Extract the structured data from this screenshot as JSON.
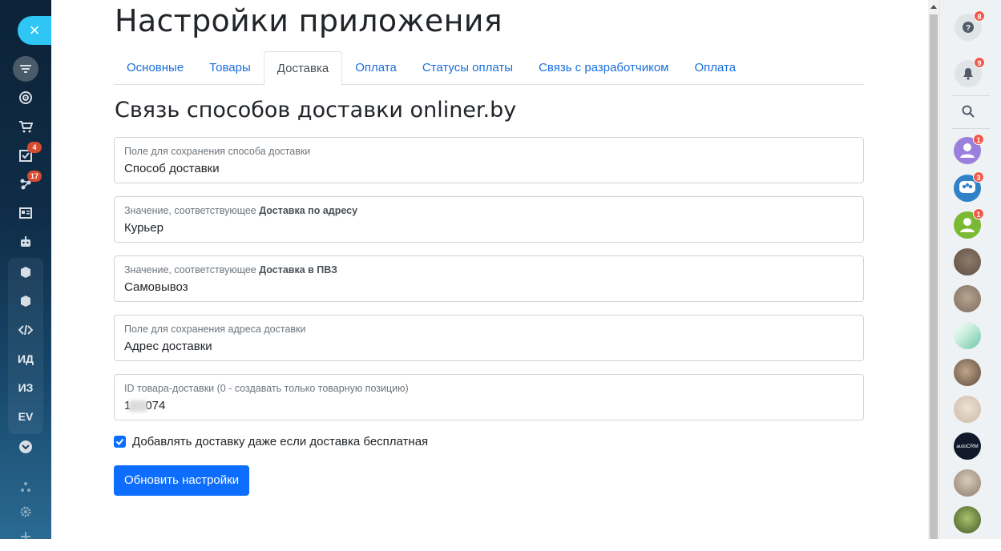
{
  "left_nav": {
    "close_label": "×",
    "text_items": [
      "ИД",
      "ИЗ",
      "EV"
    ],
    "badges": {
      "tasks": "4",
      "crm": "17"
    }
  },
  "page": {
    "app_title": "Настройки приложения",
    "tabs": [
      {
        "label": "Основные",
        "active": false
      },
      {
        "label": "Товары",
        "active": false
      },
      {
        "label": "Доставка",
        "active": true
      },
      {
        "label": "Оплата",
        "active": false
      },
      {
        "label": "Статусы оплаты",
        "active": false
      },
      {
        "label": "Связь с разработчиком",
        "active": false
      },
      {
        "label": "Оплата",
        "active": false
      }
    ],
    "section_title": "Связь способов доставки onliner.by",
    "fields": [
      {
        "label": "Поле для сохранения способа доставки",
        "label_bold": "",
        "value": "Способ доставки"
      },
      {
        "label": "Значение, соответствующее ",
        "label_bold": "Доставка по адресу",
        "value": "Курьер"
      },
      {
        "label": "Значение, соответствующее ",
        "label_bold": "Доставка в ПВЗ",
        "value": "Самовывоз"
      },
      {
        "label": "Поле для сохранения адреса доставки",
        "label_bold": "",
        "value": "Адрес доставки"
      },
      {
        "label": "ID товара-доставки (0 - создавать только товарную позицию)",
        "label_bold": "",
        "value_prefix": "1",
        "value_suffix": "074"
      }
    ],
    "checkbox": {
      "label": "Добавлять доставку даже если доставка бесплатная",
      "checked": true
    },
    "submit_label": "Обновить настройки"
  },
  "right_panel": {
    "help_badge": "8",
    "notifications_badge": "9",
    "contact_badges": [
      "1",
      "3",
      "1"
    ],
    "brand_avatar_text": "autoCRM"
  },
  "colors": {
    "accent": "#0d6efd",
    "link": "#1a6fdc",
    "sidebar_dark": "#0c2236",
    "close_button": "#2fc6f6",
    "badge": "#f0594a"
  }
}
